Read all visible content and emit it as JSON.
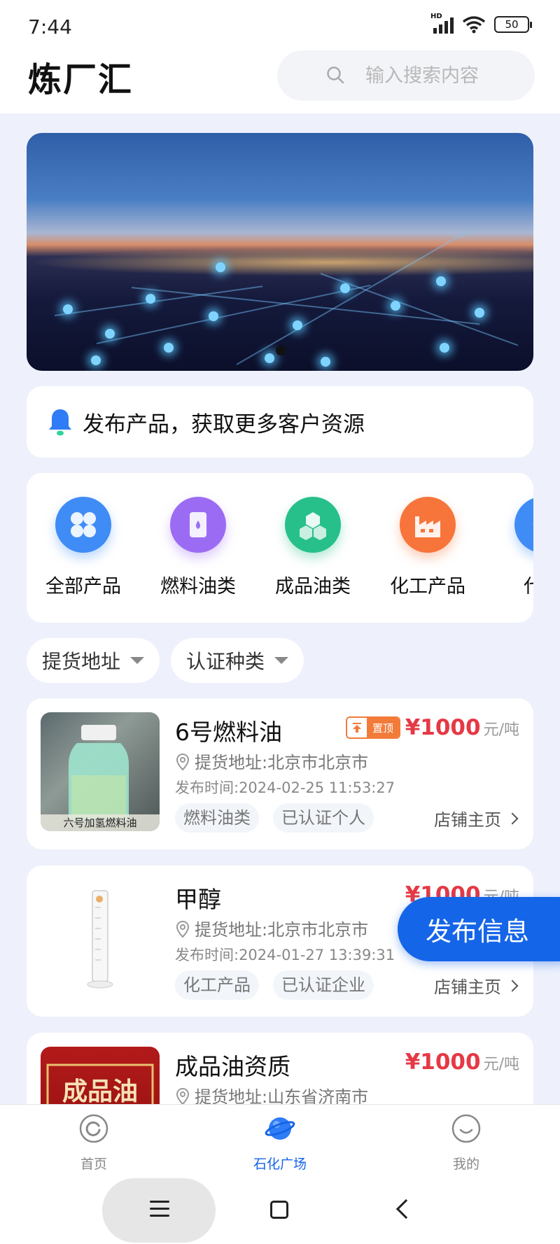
{
  "status": {
    "time": "7:44",
    "network": "HD",
    "battery": "50"
  },
  "header": {
    "title": "炼厂汇",
    "search_placeholder": "输入搜索内容"
  },
  "notice": {
    "text": "发布产品，获取更多客户资源"
  },
  "categories": [
    {
      "label": "全部产品",
      "icon": "grid-icon",
      "color": "#3f8cf6"
    },
    {
      "label": "燃料油类",
      "icon": "oil-drum-icon",
      "color": "#9b6cf3"
    },
    {
      "label": "成品油类",
      "icon": "cubes-icon",
      "color": "#27c08a"
    },
    {
      "label": "化工产品",
      "icon": "factory-icon",
      "color": "#f7743a"
    },
    {
      "label": "代办",
      "icon": "diamond-icon",
      "color": "#3f8cf6"
    }
  ],
  "filters": {
    "address": "提货地址",
    "certification": "认证种类"
  },
  "products": [
    {
      "name": "6号燃料油",
      "badge": "置顶",
      "price": "¥1000",
      "unit": "元/吨",
      "address": "提货地址:北京市北京市",
      "time": "发布时间:2024-02-25 11:53:27",
      "tags": [
        "燃料油类",
        "已认证个人"
      ],
      "shop": "店铺主页",
      "thumb_caption": "六号加氢燃料油"
    },
    {
      "name": "甲醇",
      "price": "¥1000",
      "unit": "元/吨",
      "address": "提货地址:北京市北京市",
      "time": "发布时间:2024-01-27 13:39:31",
      "tags": [
        "化工产品",
        "已认证企业"
      ],
      "shop": "店铺主页"
    },
    {
      "name": "成品油资质",
      "price": "¥1000",
      "unit": "元/吨",
      "address": "提货地址:山东省济南市",
      "thumb_caption": "成品油"
    }
  ],
  "publish_button": "发布信息",
  "tabs": [
    {
      "label": "首页",
      "icon": "home-icon"
    },
    {
      "label": "石化广场",
      "icon": "planet-icon",
      "active": true
    },
    {
      "label": "我的",
      "icon": "smile-icon"
    }
  ],
  "colors": {
    "accent": "#1565e8",
    "price": "#e53945",
    "background": "#eef1fb"
  }
}
